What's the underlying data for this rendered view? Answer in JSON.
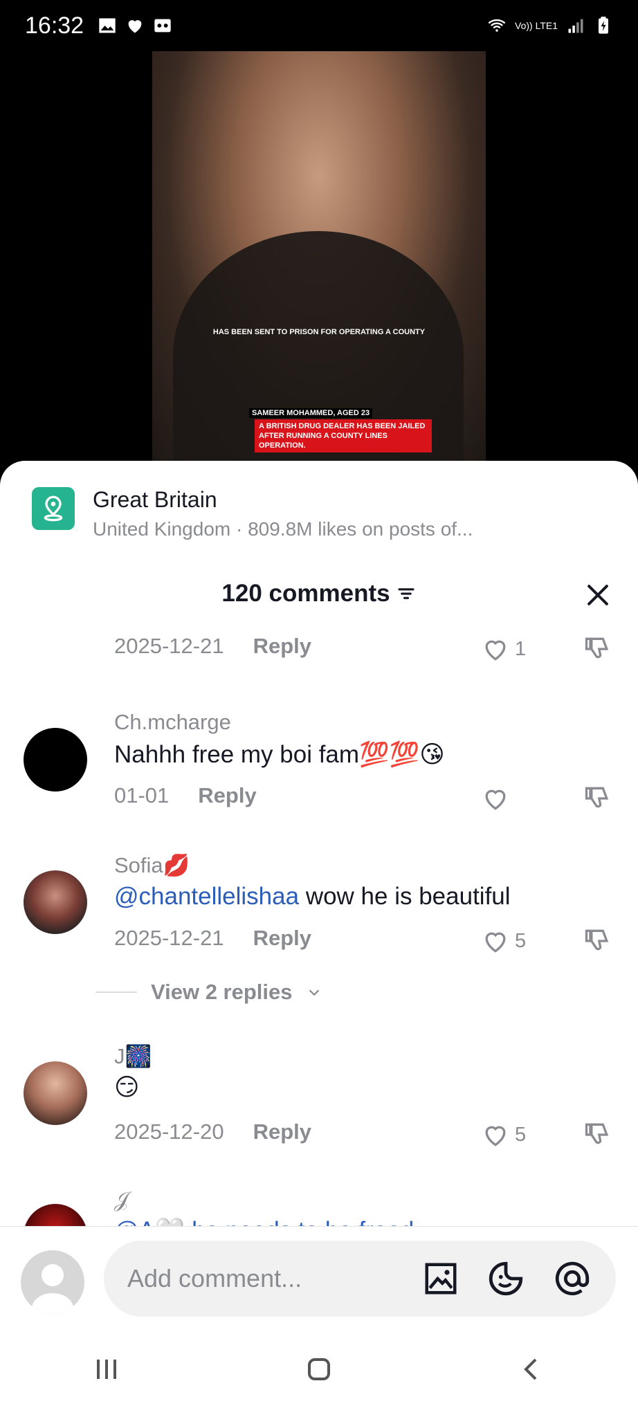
{
  "status": {
    "time": "16:32",
    "network": "Vo)) LTE1"
  },
  "video": {
    "caption_small": "HAS BEEN SENT TO PRISON FOR OPERATING A COUNTY",
    "caption_name": "SAMEER MOHAMMED, AGED 23",
    "caption_red": "A BRITISH DRUG DEALER HAS BEEN JAILED AFTER RUNNING A COUNTY LINES OPERATION."
  },
  "location": {
    "title": "Great Britain",
    "subtitle": "United Kingdom · 809.8M likes on posts of..."
  },
  "comments_header": {
    "count_label": "120 comments"
  },
  "comments": [
    {
      "user": "",
      "text": "",
      "date": "2025-12-21",
      "reply_label": "Reply",
      "likes": "1"
    },
    {
      "user": "Ch.mcharge",
      "text": "Nahhh free my boi fam💯💯😘",
      "date": "01-01",
      "reply_label": "Reply",
      "likes": ""
    },
    {
      "user": "Sofia💋",
      "mention": "@chantellelishaa",
      "text": " wow he is beautiful",
      "date": "2025-12-21",
      "reply_label": "Reply",
      "likes": "5"
    },
    {
      "user": "J🎆",
      "text": "😏",
      "date": "2025-12-20",
      "reply_label": "Reply",
      "likes": "5"
    },
    {
      "user": "𝒥",
      "text": "@A🤍 he needs to be freed"
    }
  ],
  "view_replies": "View 2 replies",
  "input": {
    "placeholder": "Add comment..."
  }
}
